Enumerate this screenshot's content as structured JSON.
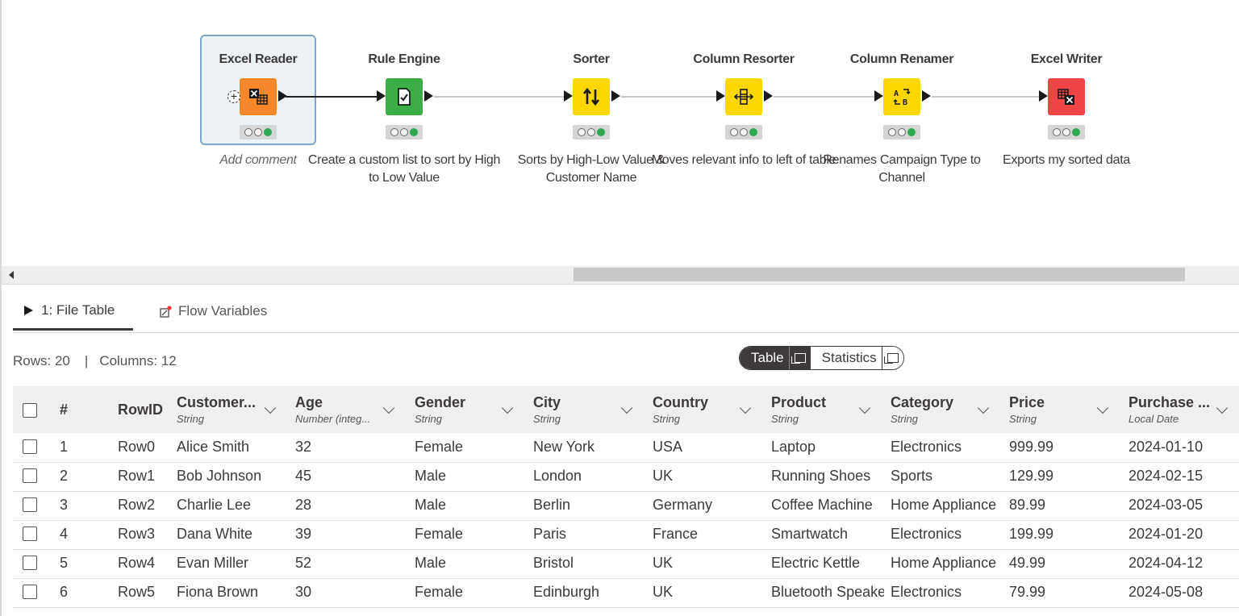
{
  "workflow": {
    "nodes": [
      {
        "title": "Excel Reader",
        "comment": "Add comment",
        "color": "#f6882c",
        "icon": "excel-reader-icon"
      },
      {
        "title": "Rule Engine",
        "comment": "Create a custom list to sort by High to Low Value",
        "color": "#3dad46",
        "icon": "rule-engine-icon"
      },
      {
        "title": "Sorter",
        "comment": "Sorts by High-Low Value & Customer Name",
        "color": "#ffd700",
        "icon": "sort-arrows-icon"
      },
      {
        "title": "Column Resorter",
        "comment": "Moves relevant info to left of table",
        "color": "#ffd700",
        "icon": "column-resorter-icon"
      },
      {
        "title": "Column Renamer",
        "comment": "Renames Campaign Type to Channel",
        "color": "#ffd700",
        "icon": "column-renamer-icon"
      },
      {
        "title": "Excel Writer",
        "comment": "Exports my sorted data",
        "color": "#ef4545",
        "icon": "excel-writer-icon"
      }
    ]
  },
  "tabs": {
    "file_table": "1: File Table",
    "flow_variables": "Flow Variables"
  },
  "info": {
    "rows": "Rows: 20",
    "sep": "|",
    "columns": "Columns: 12"
  },
  "view_toggle": {
    "table": "Table",
    "statistics": "Statistics"
  },
  "table": {
    "index_header": "#",
    "rowid_header": "RowID",
    "columns": [
      {
        "name": "Customer...",
        "type": "String"
      },
      {
        "name": "Age",
        "type": "Number (integ..."
      },
      {
        "name": "Gender",
        "type": "String"
      },
      {
        "name": "City",
        "type": "String"
      },
      {
        "name": "Country",
        "type": "String"
      },
      {
        "name": "Product",
        "type": "String"
      },
      {
        "name": "Category",
        "type": "String"
      },
      {
        "name": "Price",
        "type": "String"
      },
      {
        "name": "Purchase ...",
        "type": "Local Date"
      }
    ],
    "rows": [
      [
        "1",
        "Row0",
        "Alice Smith",
        "32",
        "Female",
        "New York",
        "USA",
        "Laptop",
        "Electronics",
        "999.99",
        "2024-01-10"
      ],
      [
        "2",
        "Row1",
        "Bob Johnson",
        "45",
        "Male",
        "London",
        "UK",
        "Running Shoes",
        "Sports",
        "129.99",
        "2024-02-15"
      ],
      [
        "3",
        "Row2",
        "Charlie Lee",
        "28",
        "Male",
        "Berlin",
        "Germany",
        "Coffee Machine",
        "Home Appliance",
        "89.99",
        "2024-03-05"
      ],
      [
        "4",
        "Row3",
        "Dana White",
        "39",
        "Female",
        "Paris",
        "France",
        "Smartwatch",
        "Electronics",
        "199.99",
        "2024-01-20"
      ],
      [
        "5",
        "Row4",
        "Evan Miller",
        "52",
        "Male",
        "Bristol",
        "UK",
        "Electric Kettle",
        "Home Appliance",
        "49.99",
        "2024-04-12"
      ],
      [
        "6",
        "Row5",
        "Fiona Brown",
        "30",
        "Female",
        "Edinburgh",
        "UK",
        "Bluetooth Speaker",
        "Electronics",
        "79.99",
        "2024-05-08"
      ]
    ]
  }
}
